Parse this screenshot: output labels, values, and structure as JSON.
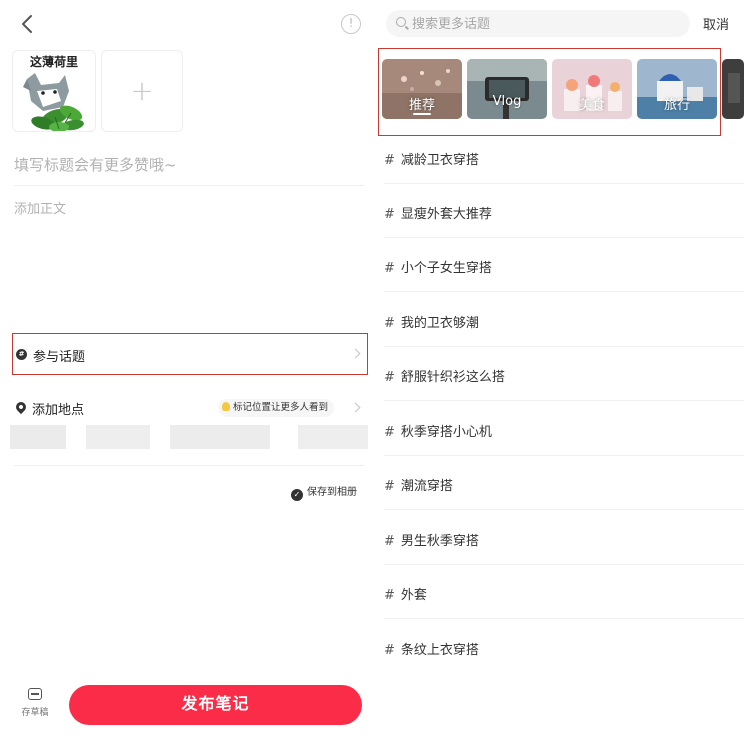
{
  "composer": {
    "image_label": "这薄荷里",
    "add_image_symbol": "+",
    "info_symbol": "!",
    "title_placeholder": "填写标题会有更多赞哦~",
    "body_placeholder": "添加正文",
    "topic_label": "参与话题",
    "location_label": "添加地点",
    "location_tip": "标记位置让更多人看到",
    "save_album_label": "保存到相册",
    "draft_label": "存草稿",
    "publish_label": "发布笔记"
  },
  "topic_search": {
    "placeholder": "搜索更多话题",
    "cancel_label": "取消",
    "categories": [
      {
        "label": "推荐",
        "selected": true
      },
      {
        "label": "Vlog",
        "selected": false
      },
      {
        "label": "美食",
        "selected": false
      },
      {
        "label": "旅行",
        "selected": false
      }
    ],
    "hash_symbol": "#",
    "topics": [
      "减龄卫衣穿搭",
      "显瘦外套大推荐",
      "小个子女生穿搭",
      "我的卫衣够潮",
      "舒服针织衫这么搭",
      "秋季穿搭小心机",
      "潮流穿搭",
      "男生秋季穿搭",
      "外套",
      "条纹上衣穿搭"
    ]
  },
  "colors": {
    "accent": "#fa2c48",
    "highlight_frame": "#c83a32"
  }
}
